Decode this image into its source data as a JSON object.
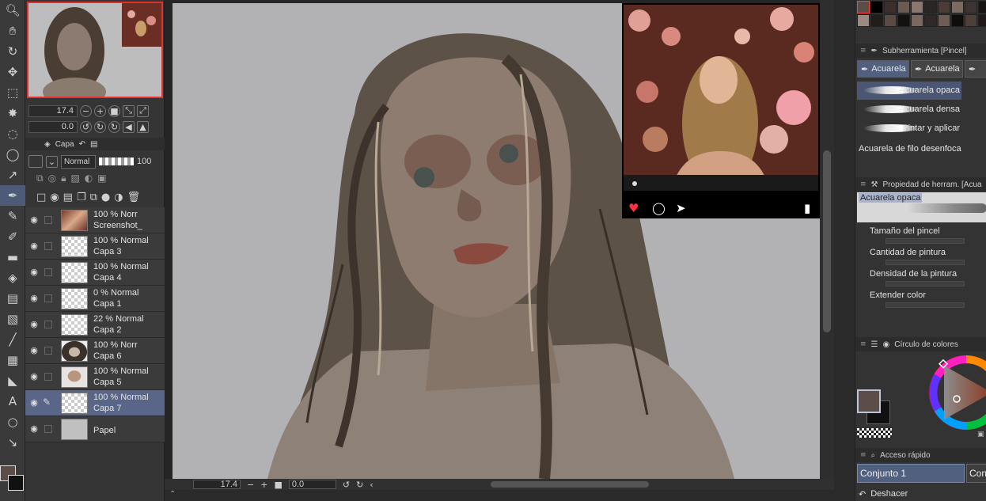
{
  "tools": [
    "zoom-icon",
    "hand-icon",
    "rotate-icon",
    "move-icon",
    "selection-icon",
    "lasso-icon",
    "wand-icon",
    "circle-icon",
    "eyedropper-icon",
    "pen-icon",
    "pencil-icon",
    "brush-icon",
    "eraser-icon",
    "blend-icon",
    "fill-icon",
    "gradient-icon",
    "figure-icon",
    "frame-icon",
    "ruler-icon",
    "text-icon",
    "balloon-icon",
    "correct-line-icon"
  ],
  "navigator": {
    "zoom_value": "17.4",
    "rotate_value": "0.0"
  },
  "layer_panel": {
    "tab_label": "Capa",
    "blend_mode": "Normal",
    "opacity": "100",
    "layers": [
      {
        "line1": "100 % Norr",
        "line2": "Screenshot_",
        "visible": true,
        "selected": false,
        "thumb": "photo"
      },
      {
        "line1": "100 % Normal",
        "line2": "Capa 3",
        "visible": true,
        "selected": false,
        "thumb": "blank"
      },
      {
        "line1": "100 % Normal",
        "line2": "Capa 4",
        "visible": true,
        "selected": false,
        "thumb": "blank"
      },
      {
        "line1": "0 % Normal",
        "line2": "Capa 1",
        "visible": true,
        "selected": false,
        "thumb": "sketch"
      },
      {
        "line1": "22 % Normal",
        "line2": "Capa 2",
        "visible": true,
        "selected": false,
        "thumb": "blank"
      },
      {
        "line1": "100 % Norr",
        "line2": "Capa 6",
        "visible": true,
        "selected": false,
        "thumb": "hair"
      },
      {
        "line1": "100 % Normal",
        "line2": "Capa 5",
        "visible": true,
        "selected": false,
        "thumb": "face"
      },
      {
        "line1": "100 % Normal",
        "line2": "Capa 7",
        "visible": true,
        "selected": true,
        "thumb": "blank"
      },
      {
        "line1": "",
        "line2": "Papel",
        "visible": true,
        "selected": false,
        "thumb": "paper"
      }
    ]
  },
  "canvas": {
    "zoom_value": "17.4",
    "rotate_value": "0.0"
  },
  "sub_tool": {
    "header": "Subherramienta [Pincel]",
    "tabs": [
      "Acuarela",
      "Acuarela"
    ],
    "brushes": [
      "Acuarela opaca",
      "Acuarela densa",
      "Pintar y aplicar",
      "Acuarela de filo desenfoca"
    ]
  },
  "tool_property": {
    "header": "Propiedad de herram. [Acua",
    "brush_name": "Acuarela opaca",
    "rows": [
      "Tamaño del pincel",
      "Cantidad de pintura",
      "Densidad de la pintura",
      "Extender color"
    ]
  },
  "color_wheel": {
    "header": "Círculo de colores",
    "main_color": "#5c4d48",
    "sub_color": "#111111"
  },
  "quick_access": {
    "header": "Acceso rápido",
    "sets": [
      "Conjunto 1",
      "Conjun"
    ],
    "undo_label": "Deshacer"
  },
  "colors": {
    "accent": "#52607f",
    "canvas_bg": "#b2b2b4",
    "panel_bg": "#353535"
  }
}
